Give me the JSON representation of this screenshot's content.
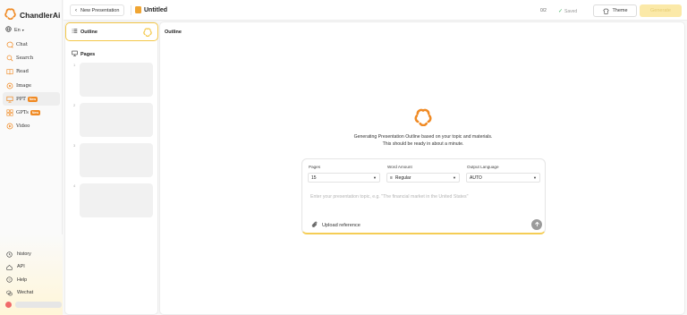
{
  "sidebar": {
    "brand": "ChandlerAi",
    "language_label": "En",
    "items": [
      {
        "label": "Chat",
        "icon": "chat-icon"
      },
      {
        "label": "Search",
        "icon": "search-icon"
      },
      {
        "label": "Read",
        "icon": "book-icon"
      },
      {
        "label": "Image",
        "icon": "image-icon"
      },
      {
        "label": "PPT",
        "icon": "ppt-icon",
        "badge": "New",
        "active": true
      },
      {
        "label": "GPTs",
        "icon": "gpts-icon",
        "badge": "New"
      },
      {
        "label": "Video",
        "icon": "video-icon"
      }
    ],
    "bottom": [
      {
        "label": "history",
        "icon": "clock-icon"
      },
      {
        "label": "API",
        "icon": "api-icon"
      },
      {
        "label": "Help",
        "icon": "help-icon"
      },
      {
        "label": "Wechat",
        "icon": "wechat-icon"
      }
    ]
  },
  "header": {
    "new_label": "New Presentation",
    "doc_title": "Untitled",
    "counter": "0/2",
    "saved": "Saved",
    "theme": "Theme",
    "generate": "Generate"
  },
  "pages_panel": {
    "outline_tab": "Outline",
    "pages_heading": "Pages",
    "thumbs": [
      "1",
      "2",
      "3",
      "4"
    ]
  },
  "main": {
    "title": "Outline",
    "status_line1": "Generating Presentation Outline based on your topic and materials.",
    "status_line2": "This should be ready in about a minute.",
    "form": {
      "pages_label": "Pages",
      "pages_value": "15",
      "word_label": "Word Amount",
      "word_value": "Regular",
      "lang_label": "Output Language",
      "lang_value": "AUTO",
      "topic_placeholder": "Enter your presentation topic, e.g. \"The financial market in the United States\"",
      "upload_label": "Upload reference"
    }
  },
  "colors": {
    "accent": "#f4c84a",
    "brand_orange": "#f08a24",
    "generate_bg": "#fbe9a8"
  }
}
